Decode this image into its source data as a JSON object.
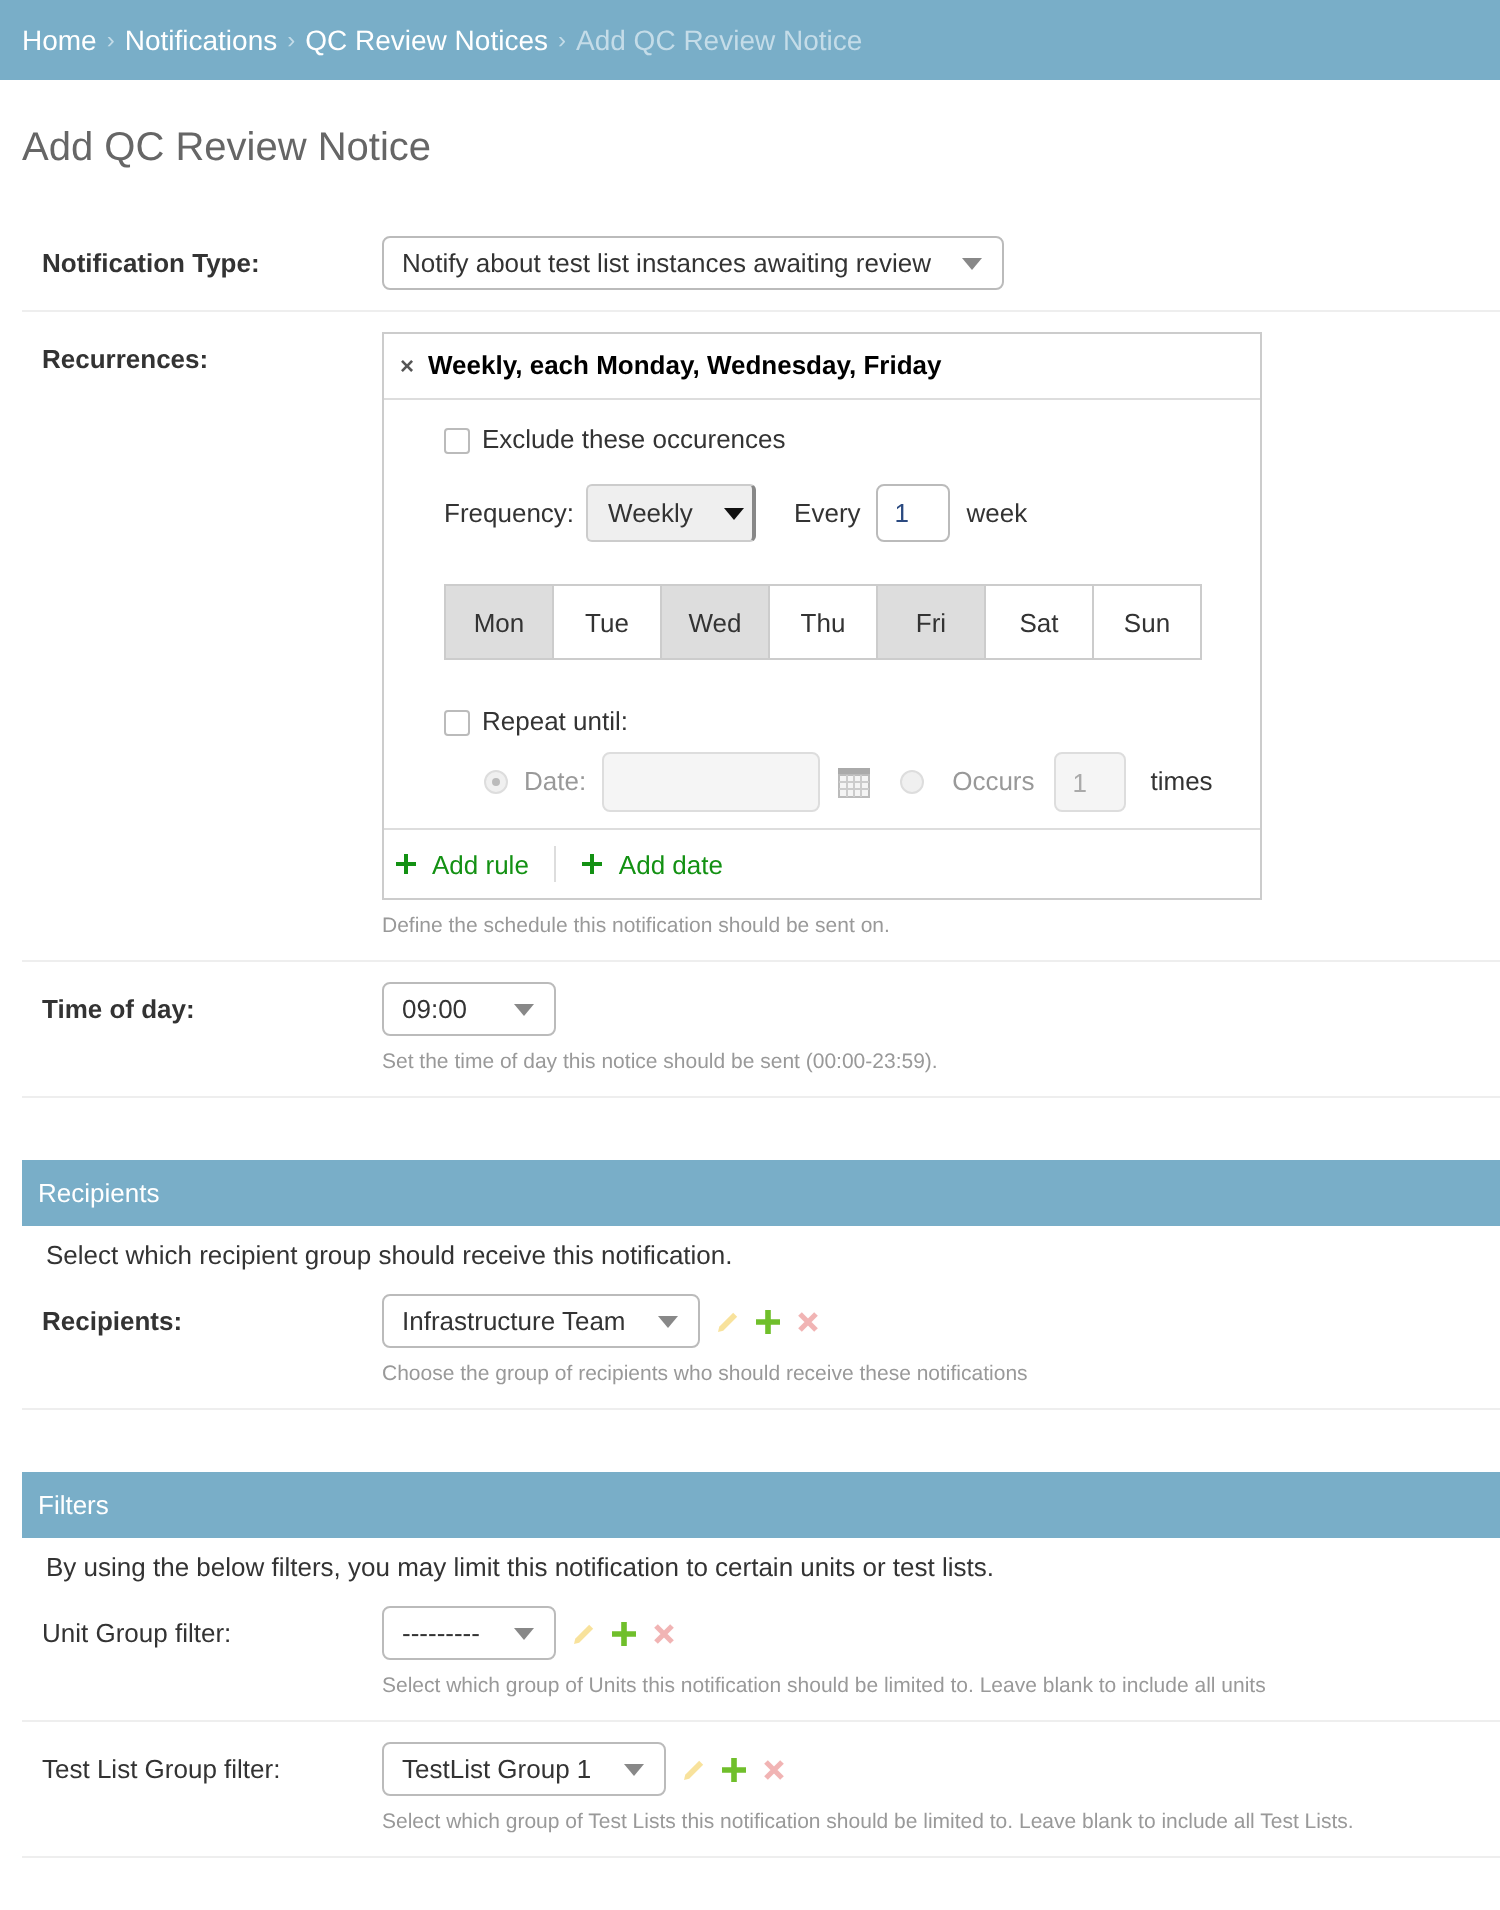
{
  "breadcrumbs": [
    {
      "label": "Home",
      "current": false
    },
    {
      "separator": "›",
      "label": "Notifications",
      "current": false
    },
    {
      "separator": "›",
      "label": "QC Review Notices",
      "current": false
    },
    {
      "separator": "›",
      "label": "Add QC Review Notice",
      "current": true
    }
  ],
  "page_title": "Add QC Review Notice",
  "fields": [
    {
      "kind": "select",
      "label": "Notification Type:",
      "required": true,
      "value": "Notify about test list instances awaiting review"
    },
    {
      "kind": "recurrence",
      "label": "Recurrences:",
      "required": true,
      "help": "Define the schedule this notification should be sent on.",
      "recurrence": {
        "remove": "×",
        "summary": "Weekly, each Monday, Wednesday, Friday",
        "exclude": {
          "label": "Exclude these occurences",
          "checked": false
        },
        "frequency": {
          "label": "Frequency:",
          "value": "Weekly"
        },
        "interval": {
          "label": "Every",
          "value": "1",
          "unit": "week"
        },
        "days": [
          {
            "label": "Mon",
            "selected": true
          },
          {
            "label": "Tue",
            "selected": false
          },
          {
            "label": "Wed",
            "selected": true
          },
          {
            "label": "Thu",
            "selected": false
          },
          {
            "label": "Fri",
            "selected": true
          },
          {
            "label": "Sat",
            "selected": false
          },
          {
            "label": "Sun",
            "selected": false
          }
        ],
        "repeat_until": {
          "label": "Repeat until:",
          "checked": false
        },
        "end": {
          "disabled": true,
          "options": [
            {
              "kind": "date",
              "label": "Date:",
              "selected": true
            },
            {
              "kind": "count",
              "label": "Occurs",
              "selected": false,
              "value": "1",
              "unit": "times"
            }
          ]
        },
        "actions": [
          {
            "label": "Add rule"
          },
          {
            "label": "Add date"
          }
        ]
      }
    },
    {
      "kind": "select",
      "label": "Time of day:",
      "required": true,
      "value": "09:00",
      "help": "Set the time of day this notice should be sent (00:00-23:59)."
    }
  ],
  "sections": [
    {
      "title": "Recipients",
      "description": "Select which recipient group should receive this notification.",
      "fields": [
        {
          "kind": "related_select",
          "label": "Recipients:",
          "required": true,
          "value": "Infrastructure Team",
          "help": "Choose the group of recipients who should receive these notifications",
          "links": [
            {
              "kind": "change",
              "disabled": true
            },
            {
              "kind": "add",
              "disabled": false
            },
            {
              "kind": "delete",
              "disabled": true
            }
          ]
        }
      ]
    },
    {
      "title": "Filters",
      "description": "By using the below filters, you may limit this notification to certain units or test lists.",
      "fields": [
        {
          "kind": "related_select",
          "label": "Unit Group filter:",
          "required": false,
          "value": "---------",
          "help": "Select which group of Units this notification should be limited to. Leave blank to include all units",
          "links": [
            {
              "kind": "change",
              "disabled": true
            },
            {
              "kind": "add",
              "disabled": false
            },
            {
              "kind": "delete",
              "disabled": true
            }
          ]
        },
        {
          "kind": "related_select",
          "label": "Test List Group filter:",
          "required": false,
          "value": "TestList Group 1",
          "help": "Select which group of Test Lists this notification should be limited to. Leave blank to include all Test Lists.",
          "links": [
            {
              "kind": "change",
              "disabled": true
            },
            {
              "kind": "add",
              "disabled": false
            },
            {
              "kind": "delete",
              "disabled": true
            }
          ]
        }
      ]
    }
  ]
}
